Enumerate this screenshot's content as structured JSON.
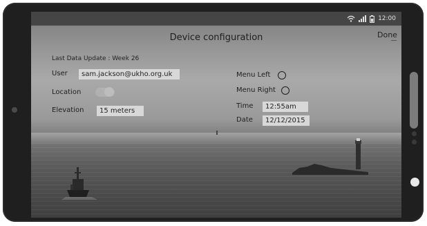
{
  "status_bar": {
    "time": "12:00",
    "icons": [
      "wifi-icon",
      "signal-icon",
      "battery-icon"
    ]
  },
  "dialog": {
    "title": "Device configuration",
    "done_label": "Done",
    "last_update": "Last Data Update : Week 26"
  },
  "form": {
    "user_label": "User",
    "user_value": "sam.jackson@ukho.org.uk",
    "location_label": "Location",
    "elevation_label": "Elevation",
    "elevation_value": "15 meters",
    "menu_left_label": "Menu Left",
    "menu_right_label": "Menu Right",
    "time_label": "Time",
    "time_value": "12:55am",
    "date_label": "Date",
    "date_value": "12/12/2015"
  }
}
